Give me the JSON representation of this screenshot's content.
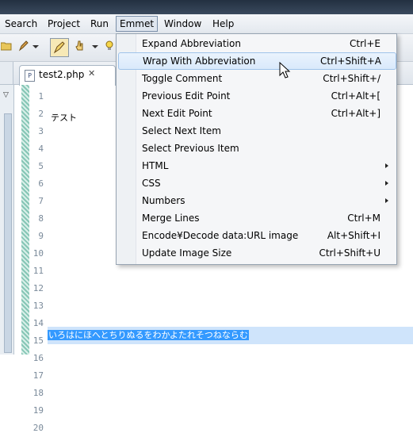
{
  "menubar": {
    "items": [
      {
        "label": "Search"
      },
      {
        "label": "Project"
      },
      {
        "label": "Run"
      },
      {
        "label": "Emmet"
      },
      {
        "label": "Window"
      },
      {
        "label": "Help"
      }
    ]
  },
  "toolbar": {
    "icons": [
      "folder-icon",
      "pen-icon",
      "highlighter-icon",
      "hand-pointer-icon",
      "lightbulb-icon"
    ]
  },
  "editor_tab": {
    "filename": "test2.php",
    "close_glyph": "✕",
    "file_icon_letter": "P"
  },
  "editor": {
    "line_numbers": [
      "1",
      "2",
      "3",
      "4",
      "5",
      "6",
      "7",
      "8",
      "9",
      "10",
      "11",
      "12",
      "13",
      "14",
      "15",
      "16",
      "17",
      "18",
      "19",
      "20"
    ],
    "line3": "テスト",
    "line20": "いろはにほへとちりぬるをわかよたれそつねならむ"
  },
  "emmet_menu": {
    "items": [
      {
        "label": "Expand Abbreviation",
        "shortcut": "Ctrl+E",
        "submenu": false
      },
      {
        "label": "Wrap With Abbreviation",
        "shortcut": "Ctrl+Shift+A",
        "submenu": false
      },
      {
        "label": "Toggle Comment",
        "shortcut": "Ctrl+Shift+/",
        "submenu": false
      },
      {
        "label": "Previous Edit Point",
        "shortcut": "Ctrl+Alt+[",
        "submenu": false
      },
      {
        "label": "Next Edit Point",
        "shortcut": "Ctrl+Alt+]",
        "submenu": false
      },
      {
        "label": "Select Next Item",
        "shortcut": "",
        "submenu": false
      },
      {
        "label": "Select Previous Item",
        "shortcut": "",
        "submenu": false
      },
      {
        "label": "HTML",
        "shortcut": "",
        "submenu": true
      },
      {
        "label": "CSS",
        "shortcut": "",
        "submenu": true
      },
      {
        "label": "Numbers",
        "shortcut": "",
        "submenu": true
      },
      {
        "label": "Merge Lines",
        "shortcut": "Ctrl+M",
        "submenu": false
      },
      {
        "label": "Encode¥Decode data:URL image",
        "shortcut": "Alt+Shift+I",
        "submenu": false
      },
      {
        "label": "Update Image Size",
        "shortcut": "Ctrl+Shift+U",
        "submenu": false
      }
    ]
  },
  "colors": {
    "selection": "#3399ff",
    "menu_hover": "#d9e9fb",
    "gutter_marker": "#86c6b6"
  }
}
